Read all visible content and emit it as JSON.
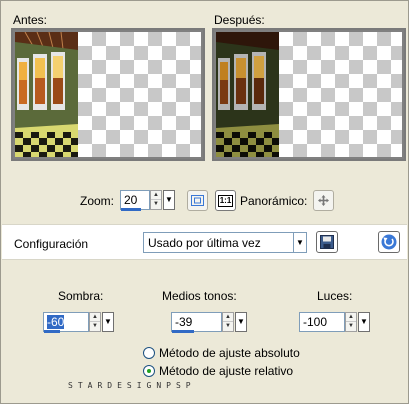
{
  "previews": {
    "before_label": "Antes:",
    "after_label": "Después:"
  },
  "zoom": {
    "label": "Zoom:",
    "value": "20",
    "fit_icon": "fit-window-icon",
    "actual_size_label": "1:1",
    "pan_label": "Panorámico:",
    "pan_icon": "pan-move-icon"
  },
  "config": {
    "label": "Configuración",
    "preset_value": "Usado por última vez",
    "save_icon": "save-disk-icon",
    "reset_icon": "reset-arrow-icon"
  },
  "controls": {
    "shadows_label": "Sombra:",
    "shadows_value": "-60",
    "midtones_label": "Medios tonos:",
    "midtones_value": "-39",
    "highlights_label": "Luces:",
    "highlights_value": "-100"
  },
  "method": {
    "absolute_label": "Método de ajuste absoluto",
    "relative_label": "Método de ajuste relativo",
    "selected": "relative"
  },
  "footer": "STARDESIGNPSP",
  "colors": {
    "dialog_bg": "#ece9d8",
    "selection": "#316ac5",
    "accent_blue": "#3a78d6"
  }
}
